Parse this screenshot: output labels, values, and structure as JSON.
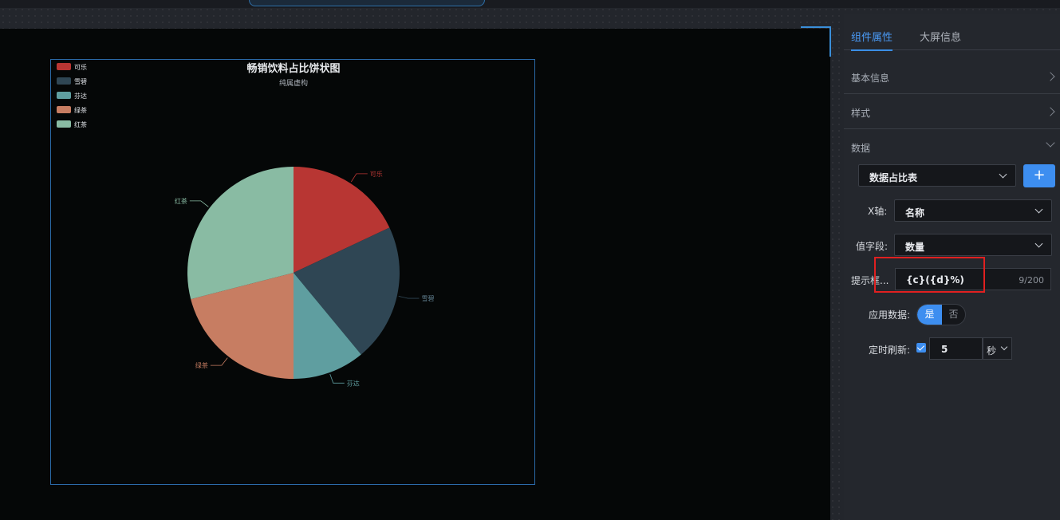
{
  "panel": {
    "tabs": [
      {
        "label": "组件属性",
        "active": true
      },
      {
        "label": "大屏信息",
        "active": false
      }
    ],
    "sections": {
      "basic": "基本信息",
      "style": "样式",
      "data": "数据"
    },
    "data_source": "数据占比表",
    "add_label": "+",
    "x_axis_label": "X轴:",
    "x_axis_value": "名称",
    "value_field_label": "值字段:",
    "value_field_value": "数量",
    "tooltip_label": "提示框...",
    "tooltip_value": "{c}({d}%)",
    "tooltip_count": "9/200",
    "apply_data_label": "应用数据:",
    "apply_yes": "是",
    "apply_no": "否",
    "refresh_label": "定时刷新:",
    "refresh_checked": true,
    "refresh_value": "5",
    "refresh_unit": "秒"
  },
  "chart_data": {
    "type": "pie",
    "title": "畅销饮料占比饼状图",
    "subtitle": "纯属虚构",
    "legend_position": "top-left",
    "categories": [
      "可乐",
      "雪碧",
      "芬达",
      "绿茶",
      "红茶"
    ],
    "values": [
      18,
      21,
      11,
      21,
      29
    ],
    "colors": [
      "#b83633",
      "#2f4654",
      "#5f9ea0",
      "#c77d62",
      "#89bba3"
    ]
  }
}
